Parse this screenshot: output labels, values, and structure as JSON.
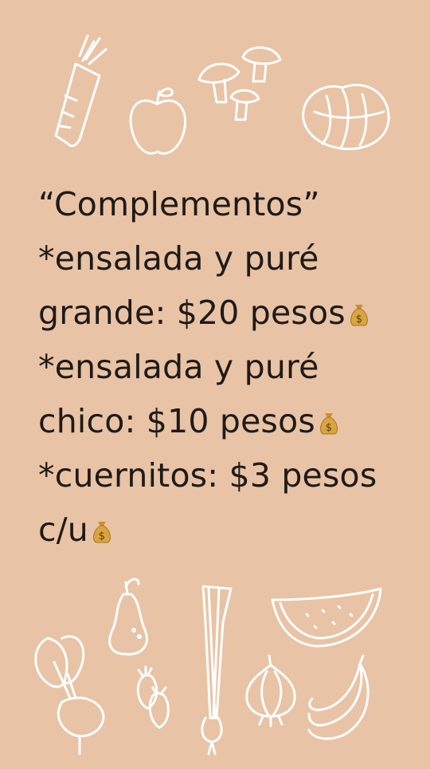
{
  "menu": {
    "title": "“Complementos”",
    "line1": "*ensalada y puré",
    "line2": "grande: $20 pesos",
    "line3": "*ensalada y puré",
    "line4": "chico: $10 pesos",
    "line5": "*cuernitos: $3 pesos",
    "line6": "c/u"
  },
  "icons": {
    "money_bag": "money-bag-icon",
    "top_doodles": [
      "carrot",
      "apple",
      "mushrooms",
      "cabbage"
    ],
    "bottom_doodles": [
      "pear",
      "beet",
      "leek",
      "strawberries",
      "onion",
      "watermelon",
      "bananas"
    ]
  },
  "colors": {
    "background": "#e8c3a5",
    "text": "#1e1a17",
    "doodle_stroke": "#ffffff",
    "bag_gold": "#d9a540"
  }
}
